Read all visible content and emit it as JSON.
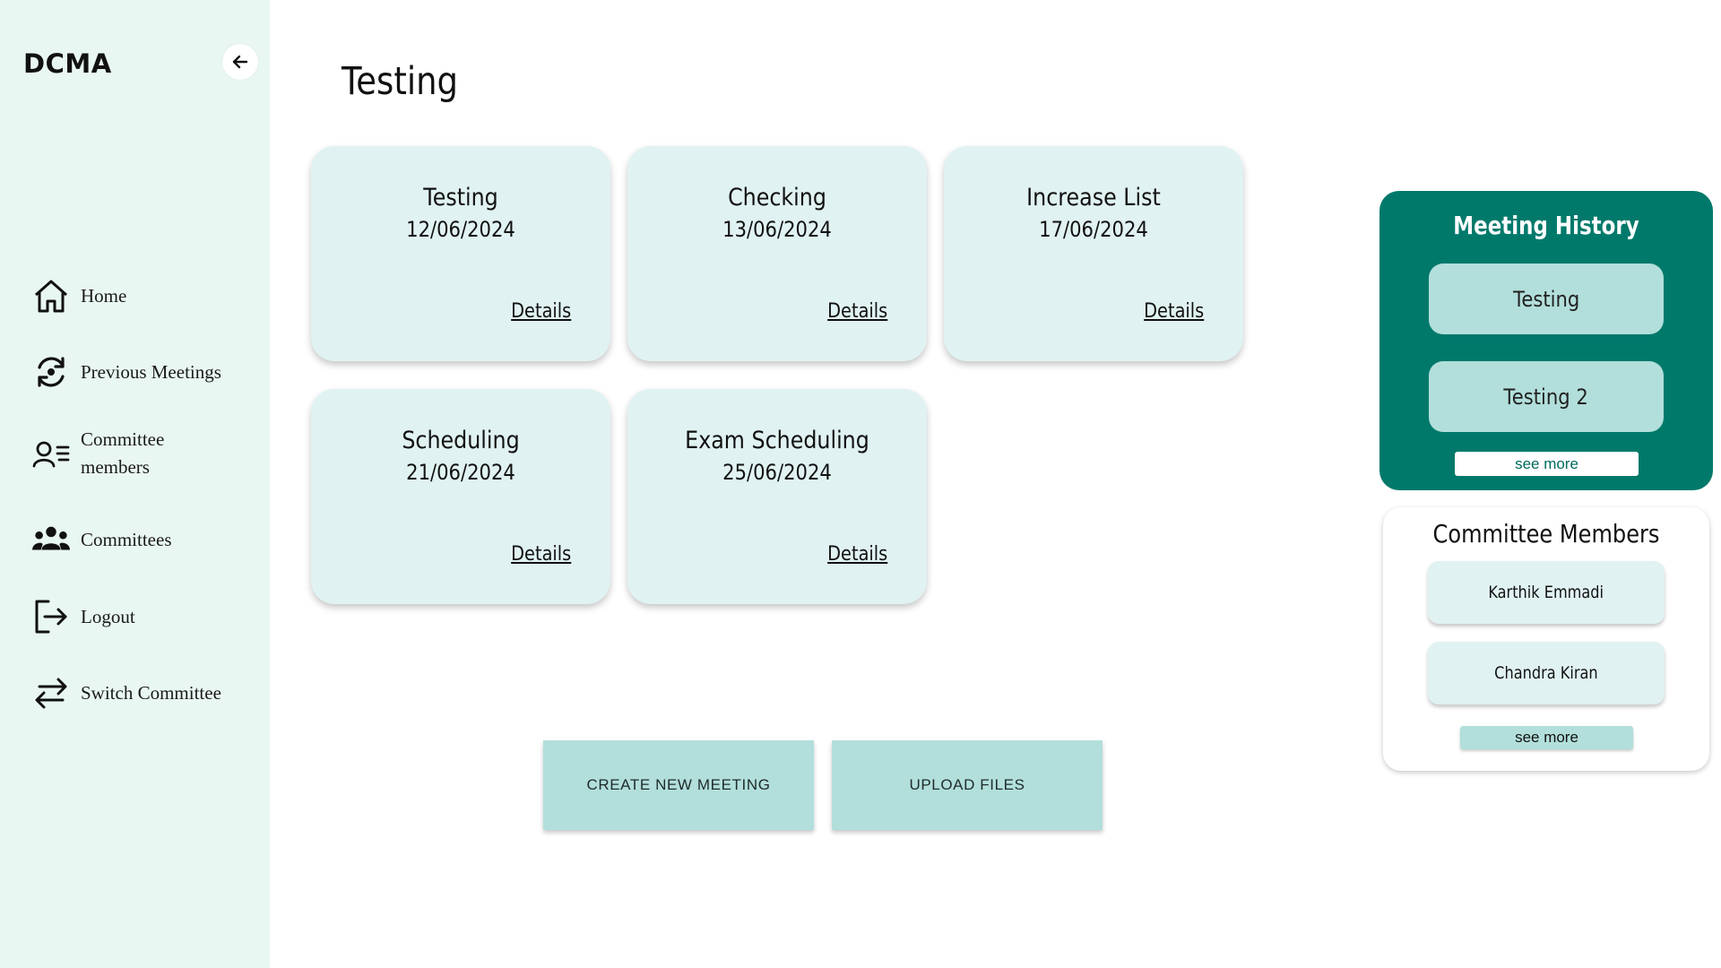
{
  "sidebar": {
    "brand": "DCMA",
    "collapse_icon": "arrow-left-icon",
    "items": [
      {
        "label": "Home",
        "icon": "home-icon"
      },
      {
        "label": "Previous Meetings",
        "icon": "previous-meetings-icon"
      },
      {
        "label": "Committee members",
        "icon": "committee-members-icon"
      },
      {
        "label": "Committees",
        "icon": "committees-icon"
      },
      {
        "label": "Logout",
        "icon": "logout-icon"
      },
      {
        "label": "Switch Committee",
        "icon": "switch-icon"
      }
    ]
  },
  "main": {
    "title": "Testing",
    "meetings": [
      {
        "title": "Testing",
        "date": "12/06/2024",
        "link": "Details"
      },
      {
        "title": "Checking",
        "date": "13/06/2024",
        "link": "Details"
      },
      {
        "title": "Increase List",
        "date": "17/06/2024",
        "link": "Details"
      },
      {
        "title": "Scheduling",
        "date": "21/06/2024",
        "link": "Details"
      },
      {
        "title": "Exam Scheduling",
        "date": "25/06/2024",
        "link": "Details"
      }
    ],
    "actions": {
      "create": "CREATE NEW MEETING",
      "upload": "UPLOAD FILES"
    }
  },
  "meeting_history": {
    "title": "Meeting History",
    "items": [
      "Testing",
      "Testing 2"
    ],
    "see_more": "see more"
  },
  "committee_members": {
    "title": "Committee Members",
    "items": [
      "Karthik Emmadi",
      "Chandra Kiran"
    ],
    "see_more": "see more"
  },
  "colors": {
    "sidebar_bg": "#e9f7f2",
    "card_bg": "#e0f2f1",
    "accent_dark": "#00796b",
    "accent_light": "#b2dfdb"
  }
}
